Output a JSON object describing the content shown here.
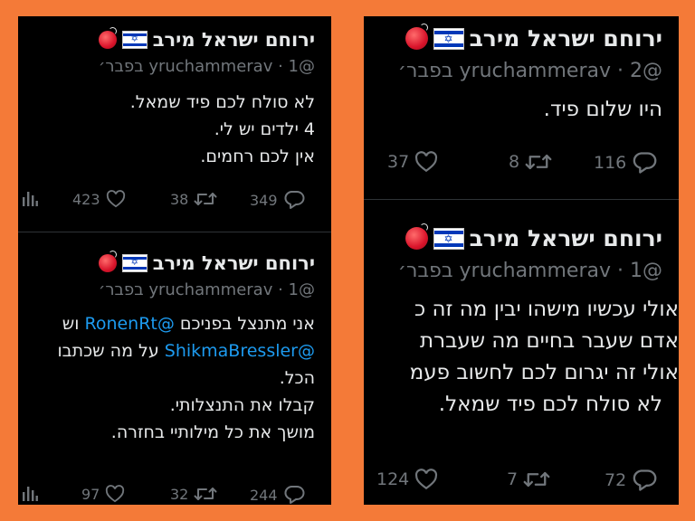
{
  "tweets": [
    {
      "name": "ירוחם ישראל מירב",
      "handle": "@yruchammerav",
      "date": "· 1 בפבר׳",
      "lines": [
        "לא סולח לכם פיד שמאל.",
        "4 ילדים יש לי.",
        "אין לכם רחמים."
      ],
      "likes": "423",
      "retweets": "38",
      "replies": "349"
    },
    {
      "name": "ירוחם ישראל מירב",
      "handle": "@yruchammerav",
      "date": "· 1 בפבר׳",
      "line1_text": "אני מתנצל בפניכם",
      "line1_mention": "@RonenRt",
      "line1_tail": "וש",
      "line2_mention": "@ShikmaBressler",
      "line2_text": "על מה שכתבו",
      "lines_rest": [
        "הכל.",
        "קבלו את התנצלותי.",
        "מושך את כל מילותיי בחזרה."
      ],
      "likes": "97",
      "retweets": "32",
      "replies": "244"
    },
    {
      "name": "ירוחם ישראל מירב",
      "handle": "@yruchammerav",
      "date": "· 2 בפבר׳",
      "lines": [
        "היו שלום פיד."
      ],
      "likes": "37",
      "retweets": "8",
      "replies": "116"
    },
    {
      "name": "ירוחם ישראל מירב",
      "handle": "@yruchammerav",
      "date": "· 1 בפבר׳",
      "lines": [
        "אולי עכשיו מישהו יבין מה זה כ",
        "אדם שעבר בחיים מה שעברת",
        "אולי זה יגרום לכם לחשוב פעמ",
        "לא סולח לכם פיד שמאל."
      ],
      "likes": "124",
      "retweets": "7",
      "replies": "72"
    }
  ],
  "colors": {
    "background": "#f47a38",
    "panel": "#000000",
    "text": "#e7e9ea",
    "muted": "#71767b",
    "mention": "#1d9bf0"
  },
  "icons": [
    "analytics-icon",
    "heart-icon",
    "retweet-icon",
    "reply-icon",
    "israel-flag-icon",
    "red-badge-icon"
  ]
}
